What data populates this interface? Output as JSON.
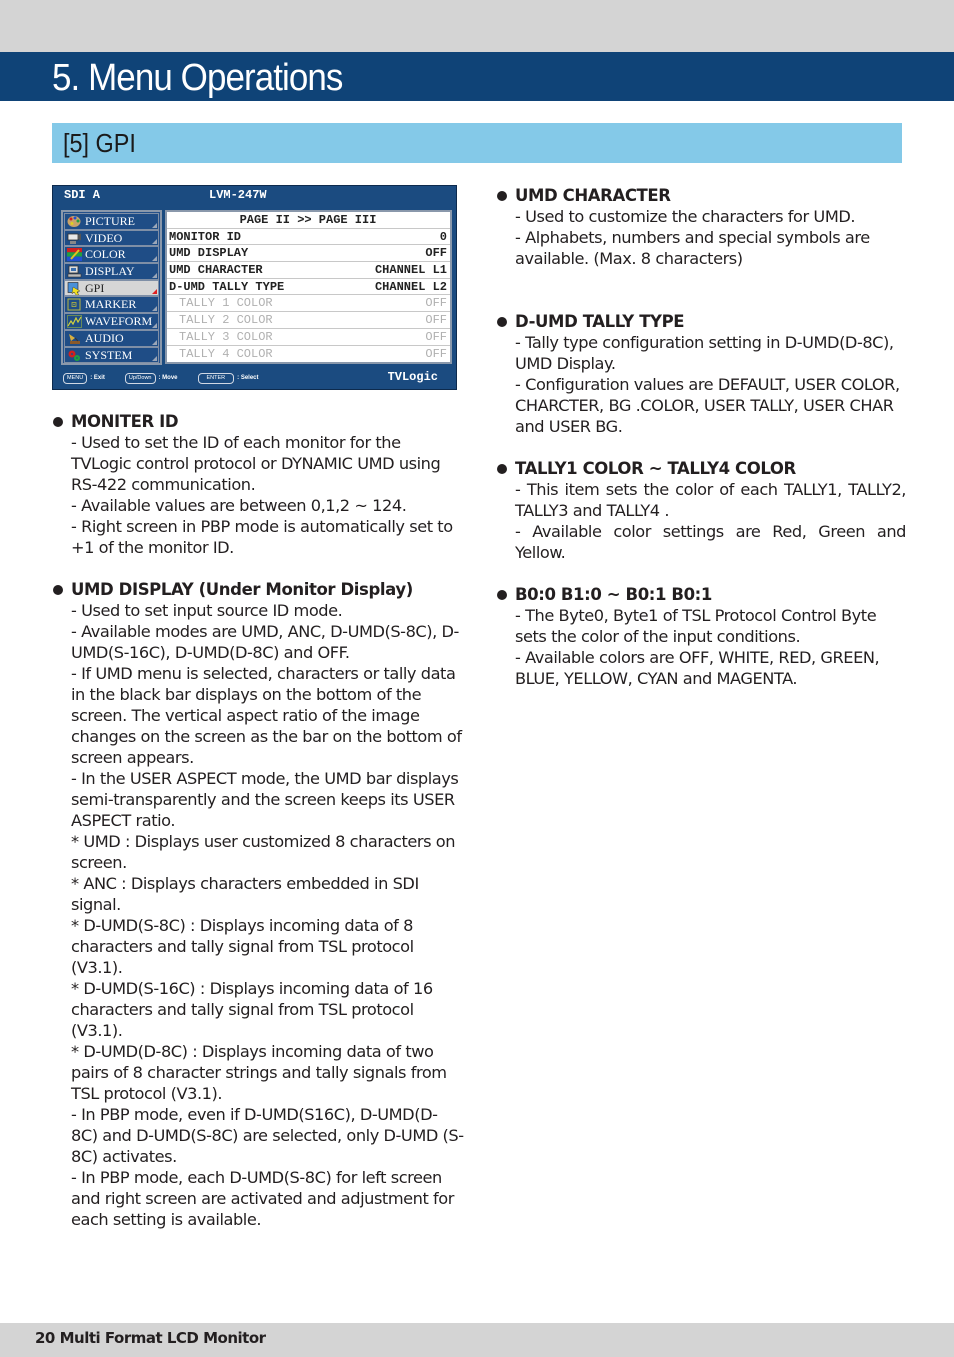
{
  "page": {
    "chapter_title": "5. Menu Operations",
    "section_title": "[5] GPI",
    "footer": "20  Multi Format LCD Monitor"
  },
  "osd": {
    "source": "SDI A",
    "model": "LVM-247W",
    "brand": "TVLogic",
    "menu": [
      {
        "label": "PICTURE",
        "icon": "palette-icon",
        "active": false
      },
      {
        "label": "VIDEO",
        "icon": "video-camera-icon",
        "active": false
      },
      {
        "label": "COLOR",
        "icon": "color-bars-icon",
        "active": false
      },
      {
        "label": "DISPLAY",
        "icon": "display-icon",
        "active": false
      },
      {
        "label": "GPI",
        "icon": "gpi-hand-icon",
        "active": true
      },
      {
        "label": "MARKER",
        "icon": "marker-icon",
        "active": false
      },
      {
        "label": "WAVEFORM",
        "icon": "waveform-icon",
        "active": false
      },
      {
        "label": "AUDIO",
        "icon": "gramophone-icon",
        "active": false
      },
      {
        "label": "SYSTEM",
        "icon": "gears-icon",
        "active": false
      }
    ],
    "panel_header": "PAGE II >> PAGE III",
    "rows": [
      {
        "label": "MONITOR ID",
        "value": "0",
        "enabled": true
      },
      {
        "label": "UMD DISPLAY",
        "value": "OFF",
        "enabled": true
      },
      {
        "label": "UMD CHARACTER",
        "value": "CHANNEL L1",
        "enabled": true
      },
      {
        "label": "D-UMD TALLY TYPE",
        "value": "CHANNEL L2",
        "enabled": true
      },
      {
        "label": "TALLY 1 COLOR",
        "value": "OFF",
        "enabled": false
      },
      {
        "label": "TALLY 2 COLOR",
        "value": "OFF",
        "enabled": false
      },
      {
        "label": "TALLY 3 COLOR",
        "value": "OFF",
        "enabled": false
      },
      {
        "label": "TALLY 4 COLOR",
        "value": "OFF",
        "enabled": false
      }
    ],
    "hints": [
      {
        "key": "MENU",
        "action": ": Exit"
      },
      {
        "key": "Up/Down",
        "action": ": Move"
      },
      {
        "key": "ENTER",
        "action": ": Select"
      }
    ]
  },
  "left_column": [
    {
      "heading": "MONITER ID",
      "lines": [
        "- Used to set the ID of each monitor for the TVLogic control protocol or DYNAMIC UMD using RS-422 communication.",
        "- Available values are between 0,1,2 ~ 124.",
        "- Right screen in PBP mode is automatically set to +1 of the monitor ID."
      ]
    },
    {
      "heading": "UMD DISPLAY (Under Monitor Display)",
      "lines": [
        "- Used to set input source ID mode.",
        "- Available modes are UMD, ANC, D-UMD(S-8C), D-UMD(S-16C), D-UMD(D-8C) and OFF.",
        "- If UMD menu is selected, characters or tally data in the black bar displays on the bottom of the screen. The vertical aspect ratio of the image changes on the screen as the bar on the bottom of screen appears.",
        "- In the USER ASPECT mode, the UMD bar displays semi-transparently and the screen keeps its USER ASPECT ratio.",
        "* UMD : Displays user customized 8 characters on screen.",
        "* ANC : Displays characters embedded in SDI signal.",
        "* D-UMD(S-8C) : Displays incoming data of 8 characters and tally signal from TSL protocol (V3.1).",
        "* D-UMD(S-16C) : Displays incoming data of 16 characters and tally signal from TSL protocol (V3.1).",
        "* D-UMD(D-8C) : Displays incoming data of two pairs of 8 character strings and tally signals from TSL protocol (V3.1).",
        "- In PBP mode, even if D-UMD(S16C), D-UMD(D-8C) and D-UMD(S-8C) are selected, only D-UMD  (S-8C) activates.",
        "- In PBP mode, each D-UMD(S-8C) for left screen and right screen are activated and adjustment for each setting is available."
      ]
    }
  ],
  "right_column": [
    {
      "heading": "UMD CHARACTER",
      "lines": [
        "- Used to customize the characters for UMD.",
        "- Alphabets, numbers and special symbols are available. (Max. 8 characters)"
      ]
    },
    {
      "heading": "D-UMD TALLY TYPE",
      "lines": [
        "- Tally type configuration setting in D-UMD(D-8C), UMD Display.",
        "- Configuration values are DEFAULT, USER COLOR, CHARCTER, BG .COLOR, USER TALLY, USER CHAR and USER BG."
      ]
    },
    {
      "heading": "TALLY1 COLOR ~ TALLY4 COLOR",
      "lines": [
        "- This item sets the color of each TALLY1, TALLY2, TALLY3 and TALLY4 .",
        "- Available color settings are  Red, Green and Yellow."
      ]
    },
    {
      "heading": "B0:0 B1:0 ~ B0:1 B0:1",
      "lines": [
        "- The Byte0, Byte1 of TSL Protocol Control Byte sets the color of the input conditions.",
        "- Available colors are OFF, WHITE, RED, GREEN, BLUE, YELLOW, CYAN and MAGENTA."
      ]
    }
  ],
  "colors": {
    "title_bar": "#0f4377",
    "section_bar": "#84c9e8",
    "osd_background": "#1b4b80",
    "gray_strip": "#d4d4d4"
  }
}
